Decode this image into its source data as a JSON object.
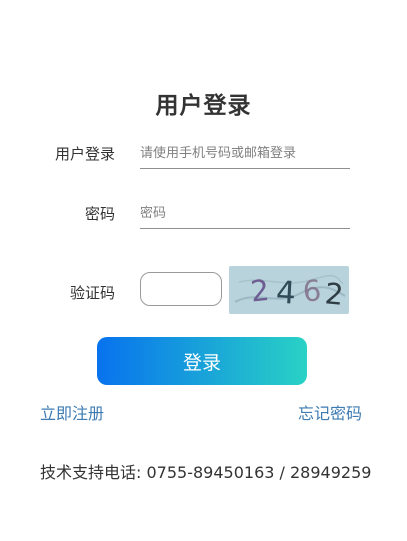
{
  "form": {
    "title": "用户登录",
    "username": {
      "label": "用户登录",
      "placeholder": "请使用手机号码或邮箱登录",
      "value": ""
    },
    "password": {
      "label": "密码",
      "placeholder": "密码",
      "value": ""
    },
    "captcha": {
      "label": "验证码",
      "value": "",
      "image_text": "2462"
    },
    "login_button": "登录"
  },
  "links": {
    "register": "立即注册",
    "forgot_password": "忘记密码"
  },
  "footer": {
    "support_label": "技术支持电话:",
    "support_phone": "0755-89450163 / 28949259"
  },
  "colors": {
    "button_gradient_start": "#0872ee",
    "button_gradient_end": "#29d2c5",
    "link": "#3d7bb2",
    "captcha_background": "#b8d3dc"
  }
}
